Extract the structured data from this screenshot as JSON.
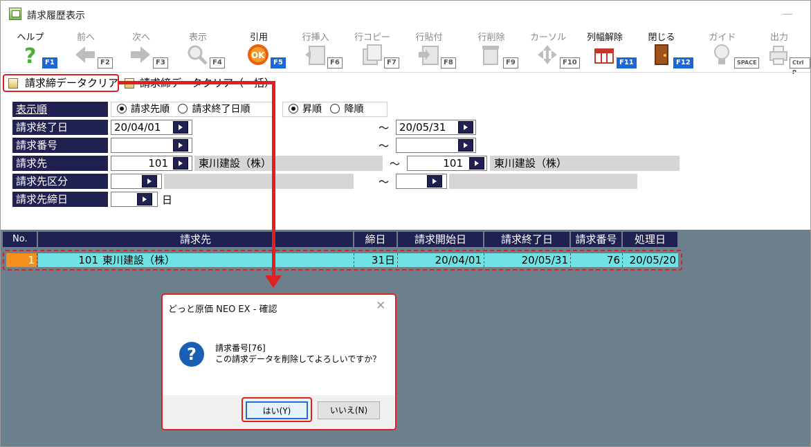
{
  "window": {
    "title": "請求履歴表示"
  },
  "toolbar": [
    {
      "label": "ヘルプ",
      "key": "F1",
      "icon": "help-icon",
      "enabled": true
    },
    {
      "label": "前へ",
      "key": "F2",
      "icon": "arrow-left-icon",
      "enabled": false
    },
    {
      "label": "次へ",
      "key": "F3",
      "icon": "arrow-right-icon",
      "enabled": false
    },
    {
      "label": "表示",
      "key": "F4",
      "icon": "magnifier-icon",
      "enabled": false
    },
    {
      "label": "引用",
      "key": "F5",
      "icon": "ok-icon",
      "enabled": true
    },
    {
      "label": "行挿入",
      "key": "F6",
      "icon": "insert-row-icon",
      "enabled": false
    },
    {
      "label": "行コピー",
      "key": "F7",
      "icon": "copy-row-icon",
      "enabled": false
    },
    {
      "label": "行貼付",
      "key": "F8",
      "icon": "paste-row-icon",
      "enabled": false
    },
    {
      "label": "行削除",
      "key": "F9",
      "icon": "delete-row-icon",
      "enabled": false
    },
    {
      "label": "カーソル",
      "key": "F10",
      "icon": "cursor-icon",
      "enabled": false
    },
    {
      "label": "列幅解除",
      "key": "F11",
      "icon": "column-width-icon",
      "enabled": true
    },
    {
      "label": "閉じる",
      "key": "F12",
      "icon": "door-icon",
      "enabled": true
    },
    {
      "label": "ガイド",
      "key": "SPACE",
      "icon": "lightbulb-icon",
      "enabled": false
    },
    {
      "label": "出力",
      "key": "Ctrl P",
      "icon": "output-icon",
      "enabled": false
    }
  ],
  "clear_buttons": {
    "clear": "請求締データクリア",
    "clear_all": "請求締データクリア（一括）"
  },
  "form": {
    "sort_label": "表示順",
    "sort_options": [
      "請求先順",
      "請求終了日順"
    ],
    "sort_selected": "請求先順",
    "order_options": [
      "昇順",
      "降順"
    ],
    "order_selected": "昇順",
    "end_date_label": "請求終了日",
    "end_date_from": "20/04/01",
    "end_date_to": "20/05/31",
    "number_label": "請求番号",
    "number_from": "",
    "number_to": "",
    "customer_label": "請求先",
    "customer_from_code": "101",
    "customer_from_name": "東川建設（株）",
    "customer_to_code": "101",
    "customer_to_name": "東川建設（株）",
    "division_label": "請求先区分",
    "closing_label": "請求先締日",
    "closing_unit": "日",
    "tilde": "～"
  },
  "grid": {
    "headers": [
      "No.",
      "請求先",
      "締日",
      "請求開始日",
      "請求終了日",
      "請求番号",
      "処理日"
    ],
    "rows": [
      {
        "no": "1",
        "customer_code": "101",
        "customer_name": "東川建設（株）",
        "closing_day": "31日",
        "start_date": "20/04/01",
        "end_date": "20/05/31",
        "number": "76",
        "processed": "20/05/20"
      }
    ]
  },
  "dialog": {
    "title": "どっと原価 NEO EX - 確認",
    "line1": "請求番号[76]",
    "line2": "この請求データを削除してよろしいですか？",
    "yes": "はい(Y)",
    "no": "いいえ(N)"
  },
  "colors": {
    "header_navy": "#1f2150",
    "highlight_red": "#e0201e",
    "row_cyan": "#6fe3e3",
    "row_no_orange": "#f3901d",
    "grid_bg": "#6b7f8c"
  }
}
